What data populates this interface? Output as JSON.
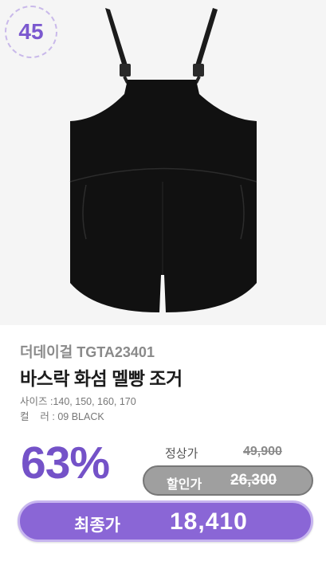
{
  "badge": {
    "number": "45"
  },
  "product": {
    "brand": "더데이걸 TGTA23401",
    "title": "바스락 화섬 멜빵 조거",
    "size_label": "사이즈 : ",
    "size_value": "140, 150, 160, 170",
    "color_label": "컬    러 : ",
    "color_value": "09 BLACK",
    "image_icon": "black-overall-shorts"
  },
  "pricing": {
    "discount": "63%",
    "regular_label": "정상가",
    "regular_price": "49,900",
    "sale_label": "할인가",
    "sale_price": "26,300",
    "final_label": "최종가",
    "final_price": "18,410"
  },
  "colors": {
    "accent": "#7452c8",
    "final_pill": "#8a66d6",
    "sale_pill": "#9f9f9f",
    "image_bg": "#f5f5f5",
    "garment": "#111111"
  }
}
